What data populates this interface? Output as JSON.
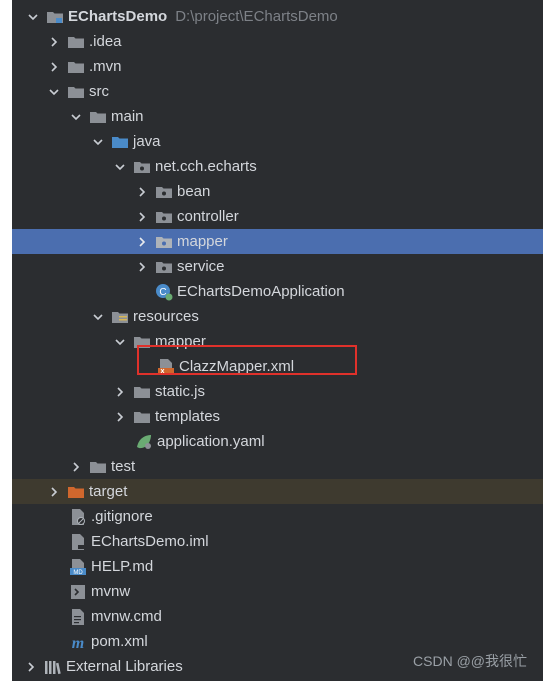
{
  "tree": {
    "project": {
      "name": "EChartsDemo",
      "path": "D:\\project\\EChartsDemo"
    },
    "items": [
      {
        "label": ".idea"
      },
      {
        "label": ".mvn"
      },
      {
        "label": "src"
      },
      {
        "label": "main"
      },
      {
        "label": "java"
      },
      {
        "label": "net.cch.echarts"
      },
      {
        "label": "bean"
      },
      {
        "label": "controller"
      },
      {
        "label": "mapper"
      },
      {
        "label": "service"
      },
      {
        "label": "EChartsDemoApplication"
      },
      {
        "label": "resources"
      },
      {
        "label": "mapper"
      },
      {
        "label": "ClazzMapper.xml"
      },
      {
        "label": "static.js"
      },
      {
        "label": "templates"
      },
      {
        "label": "application.yaml"
      },
      {
        "label": "test"
      },
      {
        "label": "target"
      },
      {
        "label": ".gitignore"
      },
      {
        "label": "EChartsDemo.iml"
      },
      {
        "label": "HELP.md"
      },
      {
        "label": "mvnw"
      },
      {
        "label": "mvnw.cmd"
      },
      {
        "label": "pom.xml"
      },
      {
        "label": "External Libraries"
      }
    ]
  },
  "watermark": "CSDN @@我很忙",
  "colors": {
    "panel": "#2b2d30",
    "selected": "#4b6eaf",
    "folder": "#8c9096",
    "source_folder": "#4a8bc9",
    "target_folder": "#d0672d",
    "highlight": "#e0312b"
  }
}
